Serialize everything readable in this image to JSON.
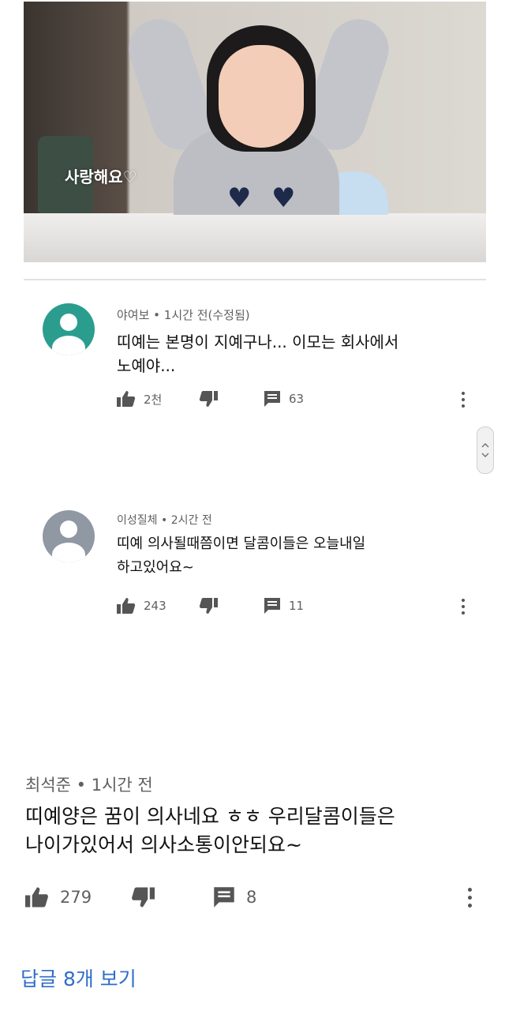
{
  "video": {
    "caption": "사랑해요♡"
  },
  "comments": [
    {
      "author": "야여보",
      "time": "1시간 전(수정됨)",
      "text_line1": "띠예는 본명이 지예구나... 이모는 회사에서",
      "text_line2": "노예야...",
      "like_count": "2천",
      "reply_count": "63",
      "avatar_color": "#2a9d8f"
    },
    {
      "author": "이성질체",
      "time": "2시간 전",
      "text_line1": "띠예 의사될때쯤이면 달콤이들은 오늘내일",
      "text_line2": "하고있어요~",
      "like_count": "243",
      "reply_count": "11",
      "avatar_color": "#8f98a3"
    },
    {
      "author": "최석준",
      "time": "1시간 전",
      "text_line1": "띠예양은 꿈이 의사네요 ㅎㅎ 우리달콤이들은",
      "text_line2": "나이가있어서 의사소통이안되요~",
      "like_count": "279",
      "reply_count": "8"
    }
  ],
  "meta_separator": " • ",
  "replies_link": "답글 8개 보기",
  "icons": {
    "like": "thumbs-up-icon",
    "dislike": "thumbs-down-icon",
    "reply": "comment-icon",
    "more": "more-vertical-icon",
    "scroll": "scroll-handle"
  },
  "colors": {
    "link": "#2f6ec9",
    "meta_text": "#606060"
  }
}
